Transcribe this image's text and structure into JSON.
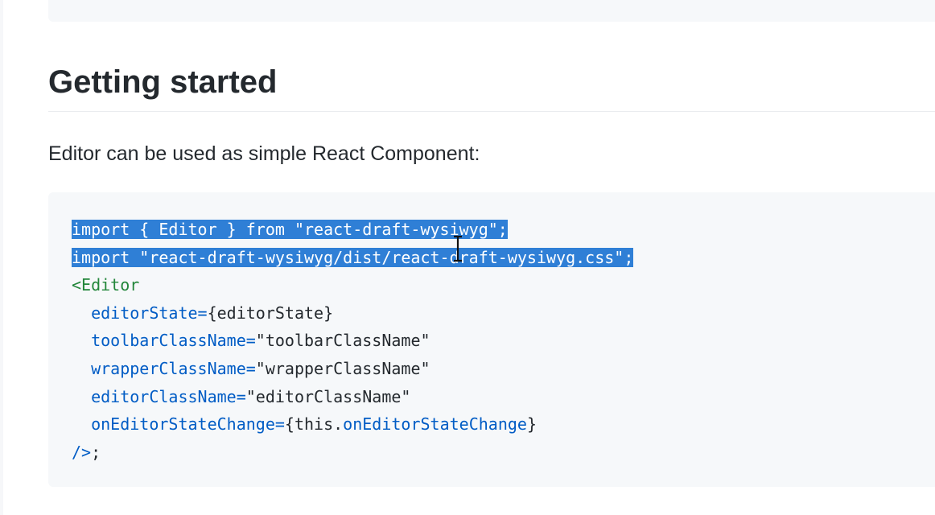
{
  "section": {
    "heading": "Getting started",
    "intro": "Editor can be used as simple React Component:"
  },
  "code": {
    "line1": "import { Editor } from \"react-draft-wysiwyg\";",
    "line2": "import \"react-draft-wysiwyg/dist/react-draft-wysiwyg.css\";",
    "line3_tag": "<Editor",
    "line4_attr": "editorState=",
    "line4_val": "{editorState}",
    "line5_attr": "toolbarClassName=",
    "line5_val": "\"toolbarClassName\"",
    "line6_attr": "wrapperClassName=",
    "line6_val": "\"wrapperClassName\"",
    "line7_attr": "editorClassName=",
    "line7_val": "\"editorClassName\"",
    "line8_attr": "onEditorStateChange=",
    "line8_brace_open": "{this.",
    "line8_member": "onEditorStateChange",
    "line8_brace_close": "}",
    "line9_close": "/>",
    "line9_semi": ";"
  },
  "colors": {
    "selection": "#2f7fd6",
    "jsx_tag": "#22863a",
    "jsx_attribute": "#005cc5",
    "code_background": "#f6f8fa"
  },
  "icons": {
    "cursor": "text-ibeam-cursor-icon"
  }
}
